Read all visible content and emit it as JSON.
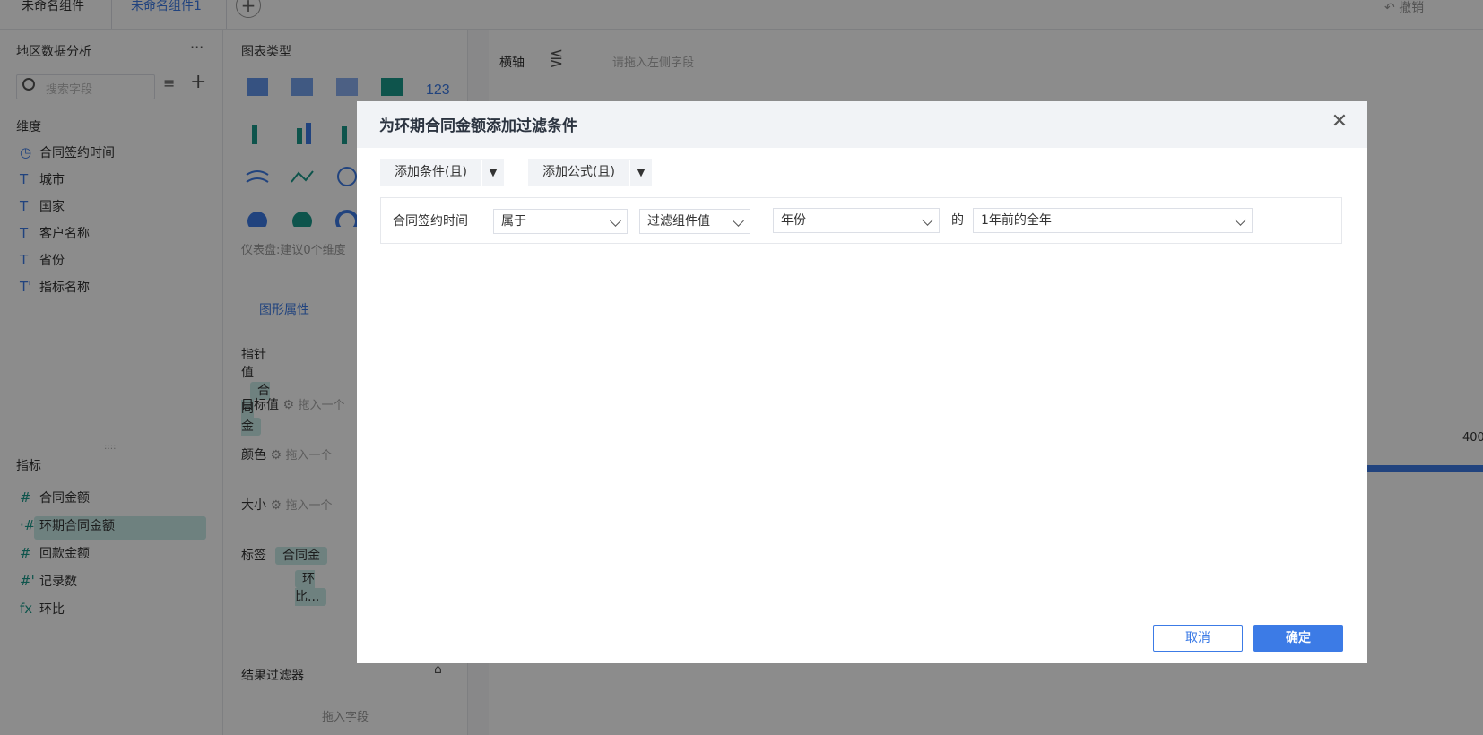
{
  "tabs": [
    "未命名组件",
    "未命名组件1"
  ],
  "undo_label": "撤销",
  "left": {
    "title": "地区数据分析",
    "more": "···",
    "search_placeholder": "搜索字段",
    "dim_title": "维度",
    "dimensions": [
      {
        "icon": "clock-icon",
        "glyph": "◷",
        "label": "合同签约时间"
      },
      {
        "icon": "text-icon",
        "glyph": "T",
        "label": "城市"
      },
      {
        "icon": "text-icon",
        "glyph": "T",
        "label": "国家"
      },
      {
        "icon": "text-icon",
        "glyph": "T",
        "label": "客户名称"
      },
      {
        "icon": "text-icon",
        "glyph": "T",
        "label": "省份"
      },
      {
        "icon": "text-icon",
        "glyph": "T'",
        "label": "指标名称"
      }
    ],
    "measure_title": "指标",
    "measures": [
      {
        "icon": "hash-icon",
        "glyph": "#",
        "label": "合同金额"
      },
      {
        "icon": "hash-icon",
        "glyph": "·#",
        "label": "环期合同金额"
      },
      {
        "icon": "hash-icon",
        "glyph": "#",
        "label": "回款金额"
      },
      {
        "icon": "hash-icon",
        "glyph": "#'",
        "label": "记录数"
      },
      {
        "icon": "formula-icon",
        "glyph": "fx",
        "label": "环比"
      }
    ]
  },
  "mid": {
    "chart_type_title": "图表类型",
    "dash_hint": "仪表盘:建议0个维度",
    "prop_tab": "图形属性",
    "rows": [
      {
        "label": "指针值",
        "value": "合同金"
      },
      {
        "label": "目标值",
        "value": "拖入一个"
      },
      {
        "label": "颜色",
        "value": "拖入一个"
      },
      {
        "label": "大小",
        "value": "拖入一个"
      },
      {
        "label": "标签",
        "value": "合同金"
      }
    ],
    "label_extra": "环比...",
    "result_filter": "结果过滤器",
    "drop_field": "拖入字段"
  },
  "canvas": {
    "axis_label": "横轴",
    "axis_placeholder": "请拖入左侧字段",
    "tick_value": "400"
  },
  "dialog": {
    "title": "为环期合同金额添加过滤条件",
    "add_condition": "添加条件(且)",
    "add_formula": "添加公式(且)",
    "condition": {
      "field": "合同签约时间",
      "operator": "属于",
      "value_type": "过滤组件值",
      "unit": "年份",
      "de": "的",
      "range": "1年前的全年"
    },
    "cancel": "取消",
    "confirm": "确定"
  },
  "colors": {
    "accent": "#3c7be6",
    "measure": "#1a9a8a",
    "highlight": "#c9ece8"
  }
}
